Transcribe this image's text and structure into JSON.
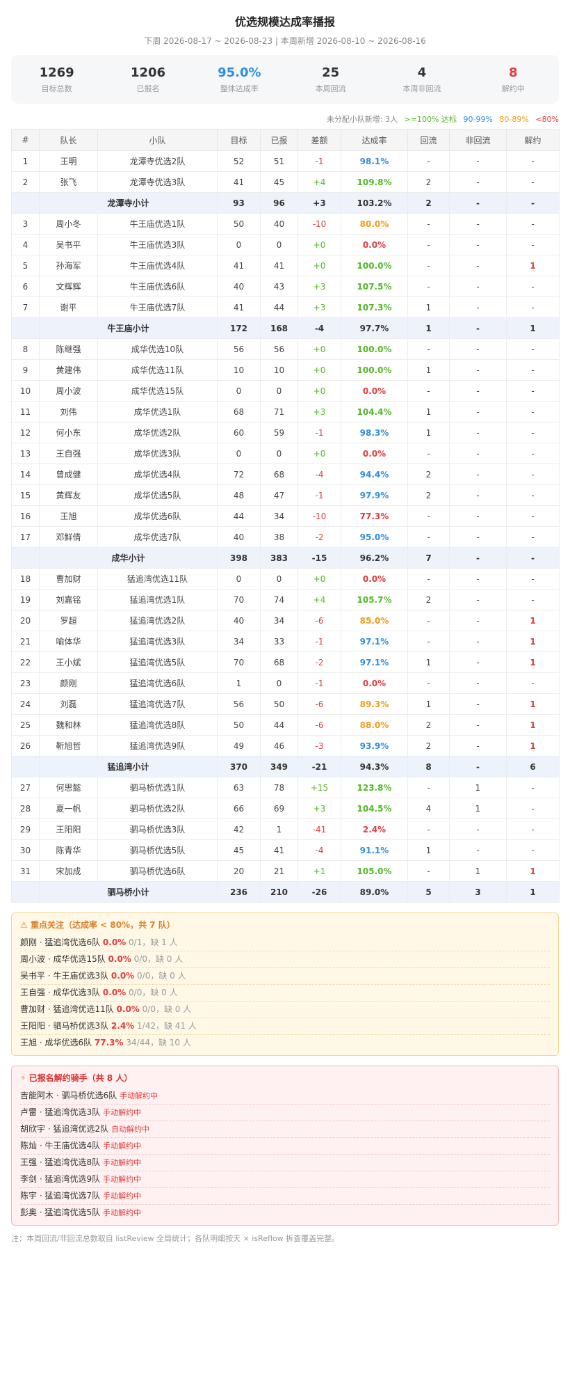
{
  "header": {
    "title": "优选规模达成率播报",
    "subtitle": "下周 2026-08-17 ~ 2026-08-23 | 本周新增 2026-08-10 ~ 2026-08-16"
  },
  "stats": [
    {
      "value": "1269",
      "label": "目标总数",
      "color": "#333333"
    },
    {
      "value": "1206",
      "label": "已报名",
      "color": "#333333"
    },
    {
      "value": "95.0%",
      "label": "整体达成率",
      "color": "#2f8ee0"
    },
    {
      "value": "25",
      "label": "本周回流",
      "color": "#333333"
    },
    {
      "value": "4",
      "label": "本周非回流",
      "color": "#333333"
    },
    {
      "value": "8",
      "label": "解约中",
      "color": "#e23b3b"
    }
  ],
  "legend": {
    "unassigned": "未分配小队新增: 3人",
    "g100": ">=100% 达标",
    "g90": "90-99%",
    "g80": "80-89%",
    "lt80": "<80%"
  },
  "table": {
    "headers": [
      "#",
      "队长",
      "小队",
      "目标",
      "已报",
      "差额",
      "达成率",
      "回流",
      "非回流",
      "解约"
    ],
    "rows": [
      {
        "type": "row",
        "idx": "1",
        "leader": "王明",
        "team": "龙潭寺优选2队",
        "target": "52",
        "enrolled": "51",
        "diff": "-1",
        "rate": "98.1%",
        "back": "-",
        "nonback": "-",
        "cancel": "-"
      },
      {
        "type": "row",
        "idx": "2",
        "leader": "张飞",
        "team": "龙潭寺优选3队",
        "target": "41",
        "enrolled": "45",
        "diff": "+4",
        "rate": "109.8%",
        "back": "2",
        "nonback": "-",
        "cancel": "-"
      },
      {
        "type": "sub",
        "label": "龙潭寺小计",
        "target": "93",
        "enrolled": "96",
        "diff": "+3",
        "rate": "103.2%",
        "back": "2",
        "nonback": "-",
        "cancel": "-"
      },
      {
        "type": "row",
        "idx": "3",
        "leader": "周小冬",
        "team": "牛王庙优选1队",
        "target": "50",
        "enrolled": "40",
        "diff": "-10",
        "rate": "80.0%",
        "back": "-",
        "nonback": "-",
        "cancel": "-"
      },
      {
        "type": "row",
        "idx": "4",
        "leader": "吴书平",
        "team": "牛王庙优选3队",
        "target": "0",
        "enrolled": "0",
        "diff": "+0",
        "rate": "0.0%",
        "back": "-",
        "nonback": "-",
        "cancel": "-"
      },
      {
        "type": "row",
        "idx": "5",
        "leader": "孙海军",
        "team": "牛王庙优选4队",
        "target": "41",
        "enrolled": "41",
        "diff": "+0",
        "rate": "100.0%",
        "back": "-",
        "nonback": "-",
        "cancel": "1"
      },
      {
        "type": "row",
        "idx": "6",
        "leader": "文辉辉",
        "team": "牛王庙优选6队",
        "target": "40",
        "enrolled": "43",
        "diff": "+3",
        "rate": "107.5%",
        "back": "-",
        "nonback": "-",
        "cancel": "-"
      },
      {
        "type": "row",
        "idx": "7",
        "leader": "谢平",
        "team": "牛王庙优选7队",
        "target": "41",
        "enrolled": "44",
        "diff": "+3",
        "rate": "107.3%",
        "back": "1",
        "nonback": "-",
        "cancel": "-"
      },
      {
        "type": "sub",
        "label": "牛王庙小计",
        "target": "172",
        "enrolled": "168",
        "diff": "-4",
        "rate": "97.7%",
        "back": "1",
        "nonback": "-",
        "cancel": "1"
      },
      {
        "type": "row",
        "idx": "8",
        "leader": "陈继强",
        "team": "成华优选10队",
        "target": "56",
        "enrolled": "56",
        "diff": "+0",
        "rate": "100.0%",
        "back": "-",
        "nonback": "-",
        "cancel": "-"
      },
      {
        "type": "row",
        "idx": "9",
        "leader": "黄建伟",
        "team": "成华优选11队",
        "target": "10",
        "enrolled": "10",
        "diff": "+0",
        "rate": "100.0%",
        "back": "1",
        "nonback": "-",
        "cancel": "-"
      },
      {
        "type": "row",
        "idx": "10",
        "leader": "周小波",
        "team": "成华优选15队",
        "target": "0",
        "enrolled": "0",
        "diff": "+0",
        "rate": "0.0%",
        "back": "-",
        "nonback": "-",
        "cancel": "-"
      },
      {
        "type": "row",
        "idx": "11",
        "leader": "刘伟",
        "team": "成华优选1队",
        "target": "68",
        "enrolled": "71",
        "diff": "+3",
        "rate": "104.4%",
        "back": "1",
        "nonback": "-",
        "cancel": "-"
      },
      {
        "type": "row",
        "idx": "12",
        "leader": "何小东",
        "team": "成华优选2队",
        "target": "60",
        "enrolled": "59",
        "diff": "-1",
        "rate": "98.3%",
        "back": "1",
        "nonback": "-",
        "cancel": "-"
      },
      {
        "type": "row",
        "idx": "13",
        "leader": "王自强",
        "team": "成华优选3队",
        "target": "0",
        "enrolled": "0",
        "diff": "+0",
        "rate": "0.0%",
        "back": "-",
        "nonback": "-",
        "cancel": "-"
      },
      {
        "type": "row",
        "idx": "14",
        "leader": "曾成健",
        "team": "成华优选4队",
        "target": "72",
        "enrolled": "68",
        "diff": "-4",
        "rate": "94.4%",
        "back": "2",
        "nonback": "-",
        "cancel": "-"
      },
      {
        "type": "row",
        "idx": "15",
        "leader": "黄辉友",
        "team": "成华优选5队",
        "target": "48",
        "enrolled": "47",
        "diff": "-1",
        "rate": "97.9%",
        "back": "2",
        "nonback": "-",
        "cancel": "-"
      },
      {
        "type": "row",
        "idx": "16",
        "leader": "王旭",
        "team": "成华优选6队",
        "target": "44",
        "enrolled": "34",
        "diff": "-10",
        "rate": "77.3%",
        "back": "-",
        "nonback": "-",
        "cancel": "-"
      },
      {
        "type": "row",
        "idx": "17",
        "leader": "邓鲜倩",
        "team": "成华优选7队",
        "target": "40",
        "enrolled": "38",
        "diff": "-2",
        "rate": "95.0%",
        "back": "-",
        "nonback": "-",
        "cancel": "-"
      },
      {
        "type": "sub",
        "label": "成华小计",
        "target": "398",
        "enrolled": "383",
        "diff": "-15",
        "rate": "96.2%",
        "back": "7",
        "nonback": "-",
        "cancel": "-"
      },
      {
        "type": "row",
        "idx": "18",
        "leader": "曹加财",
        "team": "猛追湾优选11队",
        "target": "0",
        "enrolled": "0",
        "diff": "+0",
        "rate": "0.0%",
        "back": "-",
        "nonback": "-",
        "cancel": "-"
      },
      {
        "type": "row",
        "idx": "19",
        "leader": "刘嘉铭",
        "team": "猛追湾优选1队",
        "target": "70",
        "enrolled": "74",
        "diff": "+4",
        "rate": "105.7%",
        "back": "2",
        "nonback": "-",
        "cancel": "-"
      },
      {
        "type": "row",
        "idx": "20",
        "leader": "罗超",
        "team": "猛追湾优选2队",
        "target": "40",
        "enrolled": "34",
        "diff": "-6",
        "rate": "85.0%",
        "back": "-",
        "nonback": "-",
        "cancel": "1"
      },
      {
        "type": "row",
        "idx": "21",
        "leader": "喻体华",
        "team": "猛追湾优选3队",
        "target": "34",
        "enrolled": "33",
        "diff": "-1",
        "rate": "97.1%",
        "back": "-",
        "nonback": "-",
        "cancel": "1"
      },
      {
        "type": "row",
        "idx": "22",
        "leader": "王小斌",
        "team": "猛追湾优选5队",
        "target": "70",
        "enrolled": "68",
        "diff": "-2",
        "rate": "97.1%",
        "back": "1",
        "nonback": "-",
        "cancel": "1"
      },
      {
        "type": "row",
        "idx": "23",
        "leader": "颜刚",
        "team": "猛追湾优选6队",
        "target": "1",
        "enrolled": "0",
        "diff": "-1",
        "rate": "0.0%",
        "back": "-",
        "nonback": "-",
        "cancel": "-"
      },
      {
        "type": "row",
        "idx": "24",
        "leader": "刘磊",
        "team": "猛追湾优选7队",
        "target": "56",
        "enrolled": "50",
        "diff": "-6",
        "rate": "89.3%",
        "back": "1",
        "nonback": "-",
        "cancel": "1"
      },
      {
        "type": "row",
        "idx": "25",
        "leader": "魏和林",
        "team": "猛追湾优选8队",
        "target": "50",
        "enrolled": "44",
        "diff": "-6",
        "rate": "88.0%",
        "back": "2",
        "nonback": "-",
        "cancel": "1"
      },
      {
        "type": "row",
        "idx": "26",
        "leader": "靳旭哲",
        "team": "猛追湾优选9队",
        "target": "49",
        "enrolled": "46",
        "diff": "-3",
        "rate": "93.9%",
        "back": "2",
        "nonback": "-",
        "cancel": "1"
      },
      {
        "type": "sub",
        "label": "猛追湾小计",
        "target": "370",
        "enrolled": "349",
        "diff": "-21",
        "rate": "94.3%",
        "back": "8",
        "nonback": "-",
        "cancel": "6"
      },
      {
        "type": "row",
        "idx": "27",
        "leader": "何思懿",
        "team": "驷马桥优选1队",
        "target": "63",
        "enrolled": "78",
        "diff": "+15",
        "rate": "123.8%",
        "back": "-",
        "nonback": "1",
        "cancel": "-"
      },
      {
        "type": "row",
        "idx": "28",
        "leader": "夏一帆",
        "team": "驷马桥优选2队",
        "target": "66",
        "enrolled": "69",
        "diff": "+3",
        "rate": "104.5%",
        "back": "4",
        "nonback": "1",
        "cancel": "-"
      },
      {
        "type": "row",
        "idx": "29",
        "leader": "王阳阳",
        "team": "驷马桥优选3队",
        "target": "42",
        "enrolled": "1",
        "diff": "-41",
        "rate": "2.4%",
        "back": "-",
        "nonback": "-",
        "cancel": "-"
      },
      {
        "type": "row",
        "idx": "30",
        "leader": "陈青华",
        "team": "驷马桥优选5队",
        "target": "45",
        "enrolled": "41",
        "diff": "-4",
        "rate": "91.1%",
        "back": "1",
        "nonback": "-",
        "cancel": "-"
      },
      {
        "type": "row",
        "idx": "31",
        "leader": "宋加成",
        "team": "驷马桥优选6队",
        "target": "20",
        "enrolled": "21",
        "diff": "+1",
        "rate": "105.0%",
        "back": "-",
        "nonback": "1",
        "cancel": "1"
      },
      {
        "type": "sub",
        "label": "驷马桥小计",
        "target": "236",
        "enrolled": "210",
        "diff": "-26",
        "rate": "89.0%",
        "back": "5",
        "nonback": "3",
        "cancel": "1"
      }
    ]
  },
  "focus": {
    "title": "重点关注（达成率 < 80%，共 7 队）",
    "items": [
      {
        "name": "颜刚 · 猛追湾优选6队",
        "rate": "0.0%",
        "detail": "0/1，缺 1 人"
      },
      {
        "name": "周小波 · 成华优选15队",
        "rate": "0.0%",
        "detail": "0/0，缺 0 人"
      },
      {
        "name": "吴书平 · 牛王庙优选3队",
        "rate": "0.0%",
        "detail": "0/0，缺 0 人"
      },
      {
        "name": "王自强 · 成华优选3队",
        "rate": "0.0%",
        "detail": "0/0，缺 0 人"
      },
      {
        "name": "曹加财 · 猛追湾优选11队",
        "rate": "0.0%",
        "detail": "0/0，缺 0 人"
      },
      {
        "name": "王阳阳 · 驷马桥优选3队",
        "rate": "2.4%",
        "detail": "1/42，缺 41 人"
      },
      {
        "name": "王旭 · 成华优选6队",
        "rate": "77.3%",
        "detail": "34/44，缺 10 人"
      }
    ]
  },
  "cancel": {
    "title": "已报名解约骑手（共 8 人）",
    "items": [
      {
        "name": "吉能阿木 · 驷马桥优选6队",
        "tag": "手动解约中"
      },
      {
        "name": "卢雷 · 猛追湾优选3队",
        "tag": "手动解约中"
      },
      {
        "name": "胡欣宇 · 猛追湾优选2队",
        "tag": "自动解约中"
      },
      {
        "name": "陈灿 · 牛王庙优选4队",
        "tag": "手动解约中"
      },
      {
        "name": "王强 · 猛追湾优选8队",
        "tag": "手动解约中"
      },
      {
        "name": "李剑 · 猛追湾优选9队",
        "tag": "手动解约中"
      },
      {
        "name": "陈宇 · 猛追湾优选7队",
        "tag": "手动解约中"
      },
      {
        "name": "彭奥 · 猛追湾优选5队",
        "tag": "手动解约中"
      }
    ]
  },
  "footer": {
    "note": "注：本周回流/非回流总数取自 listReview 全局统计；各队明细按天 × isReflow 拆查覆盖完整。"
  },
  "colors": {
    "green": "#52b827",
    "blue": "#2f8ee0",
    "orange": "#f39c12",
    "red": "#e23b3b"
  }
}
